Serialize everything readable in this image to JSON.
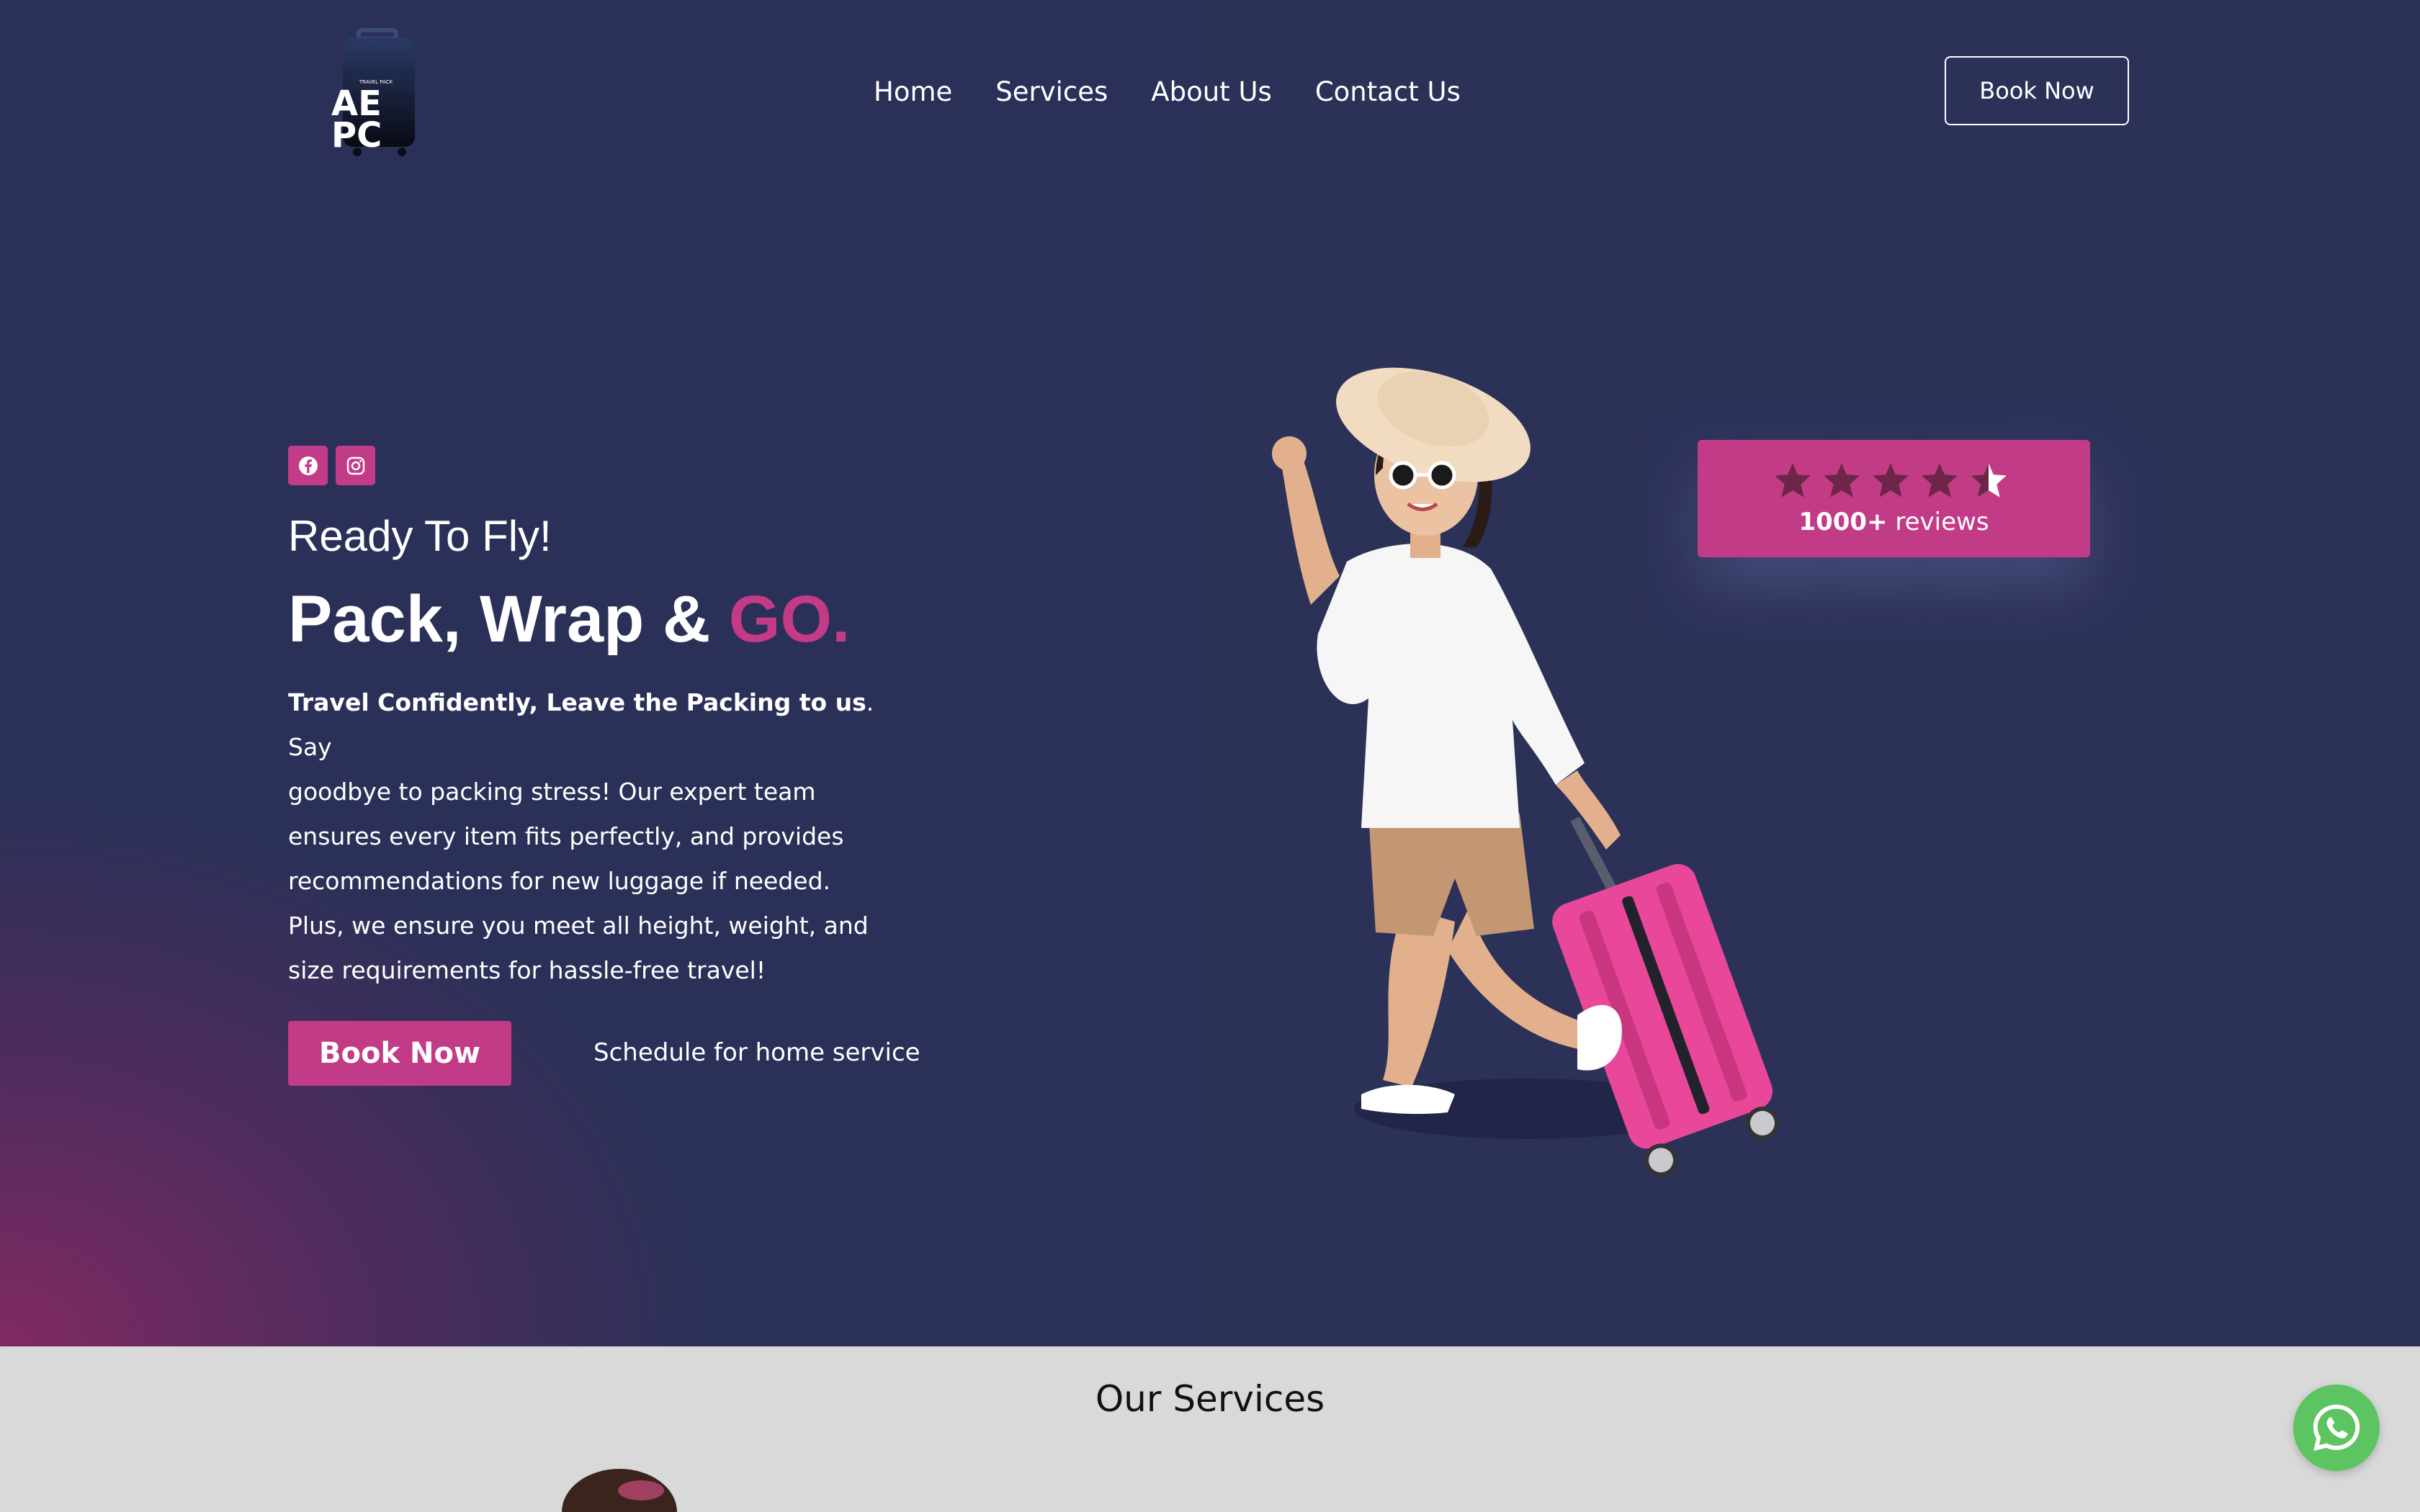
{
  "brand": {
    "logo_text_line1": "AE",
    "logo_text_line2": "PC",
    "logo_small_text": "TRAVEL PACK"
  },
  "nav": {
    "items": [
      {
        "label": "Home"
      },
      {
        "label": "Services"
      },
      {
        "label": "About Us"
      },
      {
        "label": "Contact Us"
      }
    ],
    "book_label": "Book Now"
  },
  "social": {
    "icons": [
      "facebook-icon",
      "instagram-icon"
    ]
  },
  "hero": {
    "tagline": "Ready To Fly!",
    "headline_main": "Pack, Wrap & ",
    "headline_accent": "GO.",
    "desc_bold": "Travel Confidently, Leave the Packing to us",
    "desc_period": ".",
    "desc_lines": [
      "Say",
      "goodbye to packing stress! Our expert team",
      "ensures every item fits perfectly, and provides",
      "recommendations for new luggage if needed.",
      "Plus, we ensure you meet all height, weight, and",
      "size requirements for hassle-free travel!"
    ],
    "cta_book": "Book Now",
    "cta_schedule": "Schedule for home service"
  },
  "review": {
    "count": "1000+",
    "label": " reviews",
    "rating_stars": 4.5
  },
  "services": {
    "title": "Our Services"
  },
  "colors": {
    "background": "#2c3158",
    "accent": "#c23b86",
    "services_bg": "#d9d9d9",
    "whatsapp": "#5cc460"
  }
}
